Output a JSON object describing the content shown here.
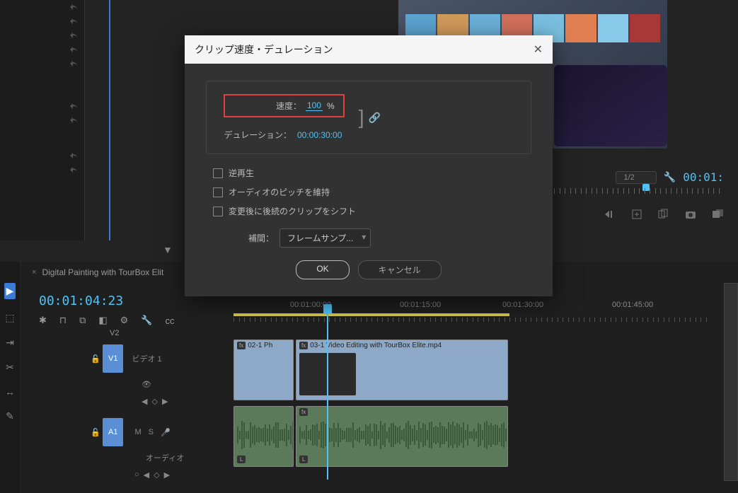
{
  "dialog": {
    "title": "クリップ速度・デュレーション",
    "speed_label": "速度：",
    "speed_value": "100",
    "percent": "%",
    "duration_label": "デュレーション：",
    "duration_value": "00:00:30:00",
    "reverse": "逆再生",
    "maintain_pitch": "オーディオのピッチを維持",
    "ripple": "変更後に後続のクリップをシフト",
    "interp_label": "補間：",
    "interp_value": "フレームサンプ...",
    "ok": "OK",
    "cancel": "キャンセル"
  },
  "preview": {
    "zoom": "1/2",
    "timecode_right": "00:01:"
  },
  "timeline": {
    "sequence_name": "Digital Painting with TourBox Elit",
    "timecode": "00:01:04:23",
    "ruler_labels": [
      "00:01:00:00",
      "00:01:15:00",
      "00:01:30:00",
      "00:01:45:00"
    ],
    "tracks": {
      "v2": "V2",
      "v1": "V1",
      "v1_name": "ビデオ 1",
      "a1": "A1",
      "a1_name": "オーディオ "
    },
    "clips": {
      "clip1": "02-1 Ph",
      "clip2": "03-1 Video Editing with TourBox Elite.mp4",
      "fx": "fx",
      "l_badge": "L"
    }
  }
}
